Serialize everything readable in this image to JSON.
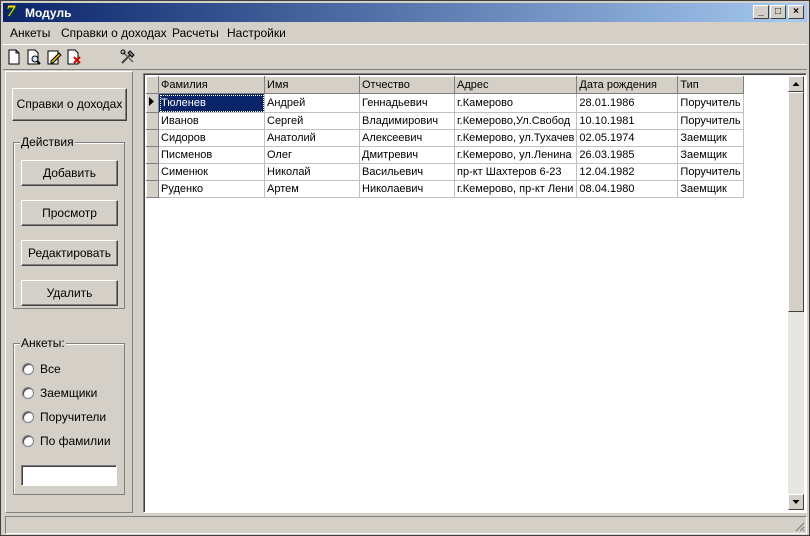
{
  "window": {
    "title": "Модуль",
    "icon_glyph": "7"
  },
  "title_buttons": {
    "minimize": "_",
    "maximize": "□",
    "close": "×"
  },
  "menu": [
    "Анкеты",
    "Справки о доходах",
    "Расчеты",
    "Настройки"
  ],
  "toolbar": {
    "icons": [
      "new-doc-icon",
      "preview-doc-icon",
      "edit-doc-icon",
      "delete-doc-icon",
      "settings-tools-icon"
    ]
  },
  "left": {
    "income_button": "Справки о доходах",
    "actions_group": "Действия",
    "add": "Добавить",
    "view": "Просмотр",
    "edit": "Редактировать",
    "delete": "Удалить",
    "filter_group": "Анкеты:",
    "filters": [
      "Все",
      "Заемщики",
      "Поручители",
      "По фамилии"
    ],
    "search_value": ""
  },
  "grid": {
    "columns": [
      "Фамилия",
      "Имя",
      "Отчество",
      "Адрес",
      "Дата рождения",
      "Тип"
    ],
    "rows": [
      [
        "Тюленев",
        "Андрей",
        "Геннадьевич",
        "г.Камерово",
        "28.01.1986",
        "Поручитель"
      ],
      [
        "Иванов",
        "Сергей",
        "Владимирович",
        "г.Кемерово,Ул.Свобод",
        "10.10.1981",
        "Поручитель"
      ],
      [
        "Сидоров",
        "Анатолий",
        "Алексеевич",
        "г.Кемерово, ул.Тухачев",
        "02.05.1974",
        "Заемщик"
      ],
      [
        "Писменов",
        "Олег",
        "Дмитревич",
        "г.Кемерово, ул.Ленина",
        "26.03.1985",
        "Заемщик"
      ],
      [
        "Сименюк",
        "Николай",
        "Васильевич",
        "пр-кт Шахтеров 6-23",
        "12.04.1982",
        "Поручитель"
      ],
      [
        "Руденко",
        "Артем",
        "Николаевич",
        "г.Кемерово, пр-кт Лени",
        "08.04.1980",
        "Заемщик"
      ]
    ]
  },
  "colors": {
    "title_start": "#0a246a",
    "title_end": "#a6caf0",
    "selection": "#0a246a",
    "face": "#d4d0c8"
  }
}
